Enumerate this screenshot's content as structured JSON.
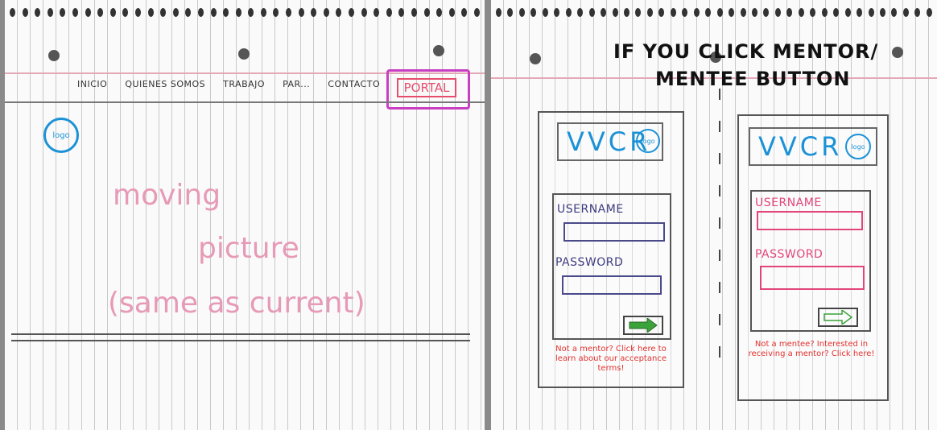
{
  "left_sketch": {
    "nav": [
      "INICIO",
      "QUIENES SOMOS",
      "TRABAJO",
      "PAR...",
      "CONTACTO"
    ],
    "portal_button": "PORTAL",
    "logo": "logo",
    "hero_lines": [
      "moving",
      "picture",
      "(same as current)"
    ]
  },
  "right_sketch": {
    "heading_lines": [
      "IF YOU CLICK MENTOR/",
      "MENTEE BUTTON"
    ],
    "mentor_card": {
      "brand": "VVCR",
      "logo": "logo",
      "username_label": "USERNAME",
      "password_label": "PASSWORD",
      "note": "Not a mentor? Click here to learn about our acceptance terms!"
    },
    "mentee_card": {
      "brand": "VVCR",
      "logo": "logo",
      "username_label": "USERNAME",
      "password_label": "PASSWORD",
      "note": "Not a mentee? Interested in receiving a mentor? Click here!"
    }
  },
  "colors": {
    "accent_blue": "#1c92d6",
    "accent_pink": "#e74d6d",
    "accent_purple": "#c93fc2",
    "mentor_field": "#4a4a8a",
    "mentee_field": "#e2457a",
    "arrow_green": "#3aa33a",
    "note_red": "#e2322f"
  }
}
